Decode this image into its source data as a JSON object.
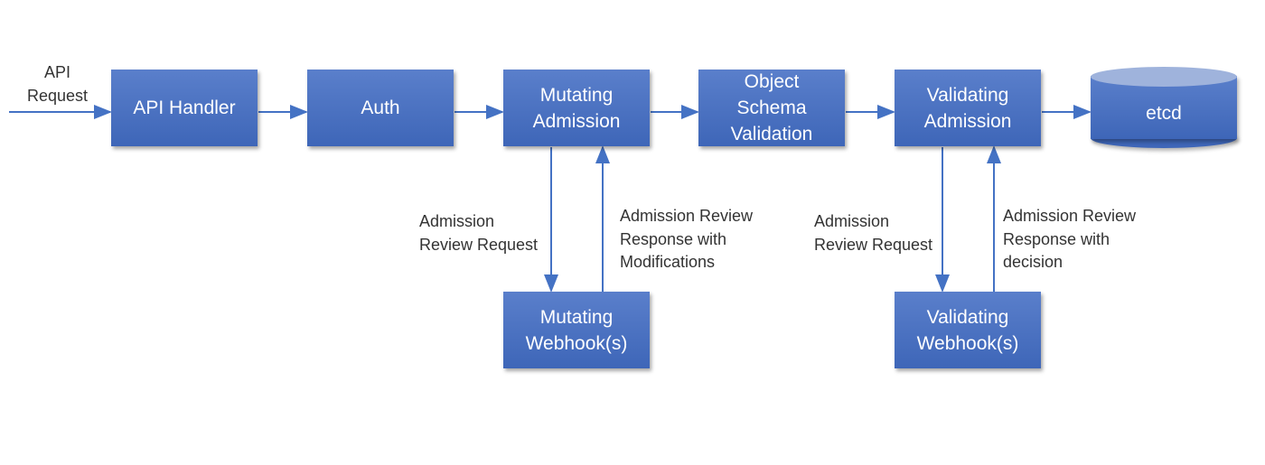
{
  "colors": {
    "box": "#4a70bf",
    "arrow": "#4472c4",
    "label": "#333333"
  },
  "input_label": "API\nRequest",
  "pipeline": [
    "API Handler",
    "Auth",
    "Mutating\nAdmission",
    "Object\nSchema\nValidation",
    "Validating\nAdmission"
  ],
  "datastore": "etcd",
  "webhooks": {
    "mutating": {
      "box": "Mutating\nWebhook(s)",
      "request_label": "Admission\nReview Request",
      "response_label": "Admission Review\nResponse with\nModifications"
    },
    "validating": {
      "box": "Validating\nWebhook(s)",
      "request_label": "Admission\nReview Request",
      "response_label": "Admission Review\nResponse with\ndecision"
    }
  }
}
